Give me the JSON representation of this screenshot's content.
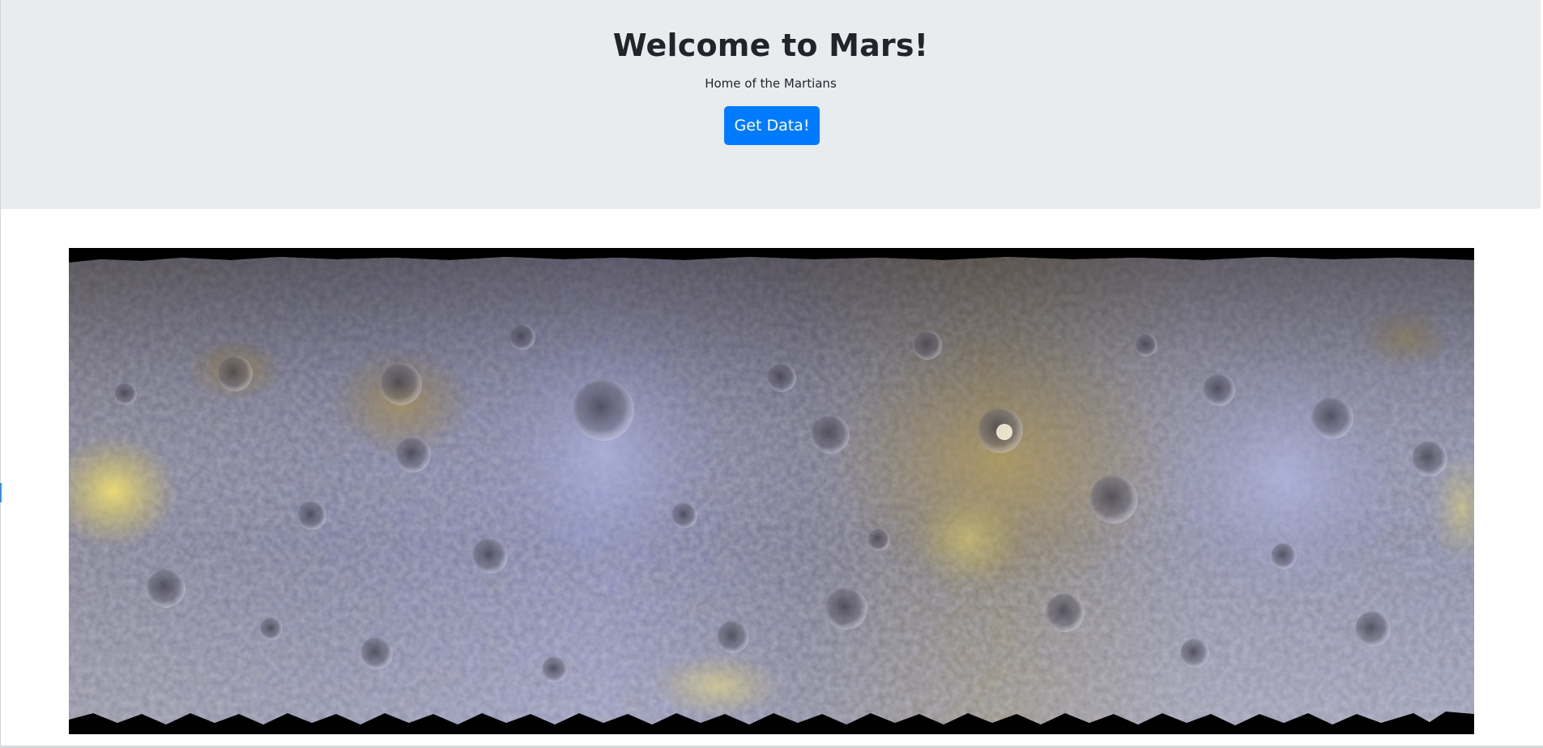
{
  "header": {
    "title": "Welcome to Mars!",
    "subtitle": "Home of the Martians",
    "button_label": "Get Data!"
  },
  "colors": {
    "jumbotron_background": "#e9ecef",
    "button_background": "#007bff",
    "text": "#212529"
  },
  "image": {
    "kind": "planetary-surface-map"
  }
}
